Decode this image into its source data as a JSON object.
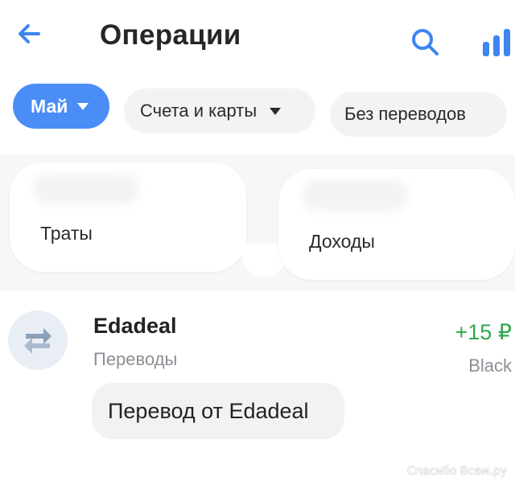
{
  "header": {
    "title": "Операции",
    "back_icon": "arrow-left-icon",
    "search_icon": "search-icon",
    "stats_icon": "bar-chart-icon"
  },
  "filters": {
    "month": "Май",
    "accounts": "Счета и карты",
    "transfers": "Без переводов"
  },
  "summary": {
    "spend_label": "Траты",
    "income_label": "Доходы"
  },
  "operation": {
    "name": "Edadeal",
    "category": "Переводы",
    "amount": "+15 ₽",
    "account": "Black",
    "comment": "Перевод от Edadeal",
    "icon": "transfer-arrows-icon"
  },
  "watermark": "Спасибо Всем.ру",
  "colors": {
    "accent": "#4a8df6",
    "income_green": "#2fa84f",
    "secondary_text": "#8b8f95",
    "chip_bg": "#f2f3f5"
  }
}
